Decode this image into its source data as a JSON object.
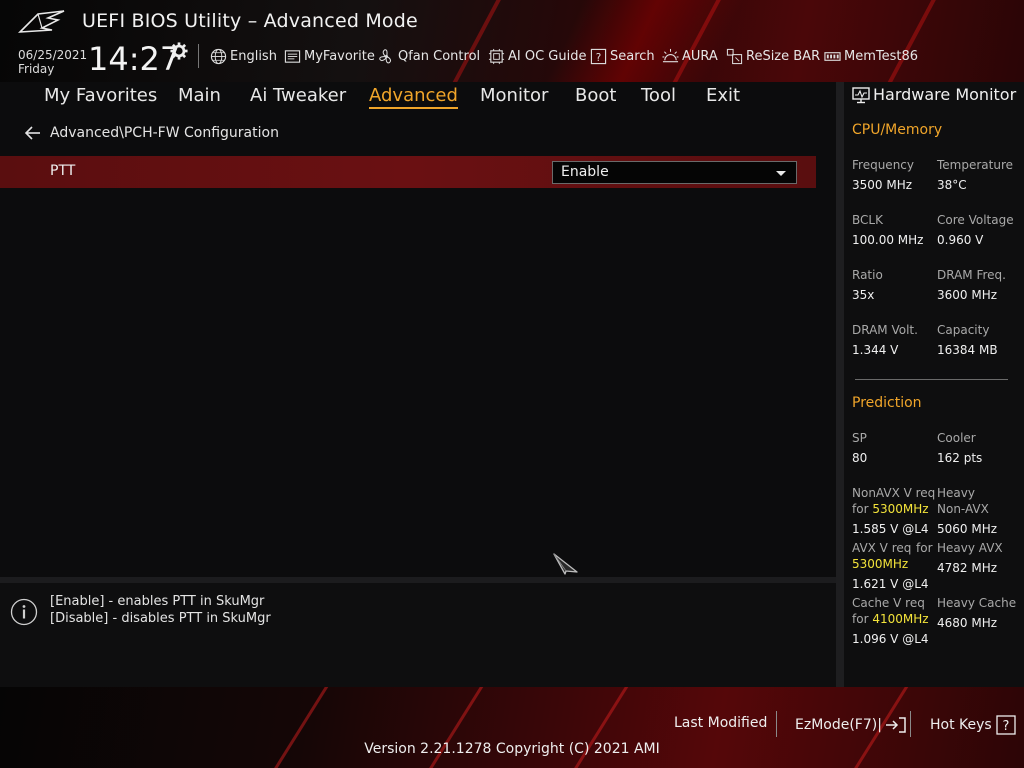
{
  "header": {
    "title": "UEFI BIOS Utility – Advanced Mode",
    "date": "06/25/2021",
    "day": "Friday",
    "time": "14:27",
    "toolbar": [
      {
        "label": "English",
        "icon": "globe-icon"
      },
      {
        "label": "MyFavorite",
        "icon": "favorite-icon"
      },
      {
        "label": "Qfan Control",
        "icon": "fan-icon"
      },
      {
        "label": "AI OC Guide",
        "icon": "ai-guide-icon"
      },
      {
        "label": "Search",
        "icon": "search-icon"
      },
      {
        "label": "AURA",
        "icon": "aura-icon"
      },
      {
        "label": "ReSize BAR",
        "icon": "resize-bar-icon"
      },
      {
        "label": "MemTest86",
        "icon": "memtest-icon"
      }
    ]
  },
  "nav": {
    "tabs": [
      "My Favorites",
      "Main",
      "Ai Tweaker",
      "Advanced",
      "Monitor",
      "Boot",
      "Tool",
      "Exit"
    ],
    "active": "Advanced"
  },
  "main": {
    "breadcrumb": "Advanced\\PCH-FW Configuration",
    "settings": [
      {
        "label": "PTT",
        "value": "Enable"
      }
    ],
    "help": [
      "[Enable] - enables PTT in SkuMgr",
      "[Disable] - disables PTT in SkuMgr"
    ]
  },
  "hardware_monitor": {
    "title": "Hardware Monitor",
    "cpu_memory": {
      "title": "CPU/Memory",
      "frequency_label": "Frequency",
      "frequency": "3500 MHz",
      "temperature_label": "Temperature",
      "temperature": "38°C",
      "bclk_label": "BCLK",
      "bclk": "100.00 MHz",
      "core_voltage_label": "Core Voltage",
      "core_voltage": "0.960 V",
      "ratio_label": "Ratio",
      "ratio": "35x",
      "dram_freq_label": "DRAM Freq.",
      "dram_freq": "3600 MHz",
      "dram_volt_label": "DRAM Volt.",
      "dram_volt": "1.344 V",
      "capacity_label": "Capacity",
      "capacity": "16384 MB"
    },
    "prediction": {
      "title": "Prediction",
      "sp_label": "SP",
      "sp": "80",
      "cooler_label": "Cooler",
      "cooler": "162 pts",
      "nonavx_label": "NonAVX V req",
      "nonavx_for": "for",
      "nonavx_freq": "5300MHz",
      "nonavx_value": "1.585 V @L4",
      "heavy_nonavx_label_1": "Heavy",
      "heavy_nonavx_label_2": "Non-AVX",
      "heavy_nonavx_value": "5060 MHz",
      "avx_label": "AVX V req",
      "avx_for": "for",
      "avx_freq": "5300MHz",
      "avx_value": "1.621 V @L4",
      "heavy_avx_label": "Heavy AVX",
      "heavy_avx_value": "4782 MHz",
      "cache_label": "Cache V req",
      "cache_for": "for",
      "cache_freq": "4100MHz",
      "cache_value": "1.096 V @L4",
      "heavy_cache_label": "Heavy Cache",
      "heavy_cache_value": "4680 MHz"
    }
  },
  "footer": {
    "last_modified": "Last Modified",
    "ezmode": "EzMode(F7)|",
    "hot_keys": "Hot Keys",
    "version": "Version 2.21.1278 Copyright (C) 2021 AMI"
  },
  "colors": {
    "accent": "#f0a52a",
    "highlight_row": "#6a1012",
    "frequency_highlight": "#f3e33a"
  }
}
